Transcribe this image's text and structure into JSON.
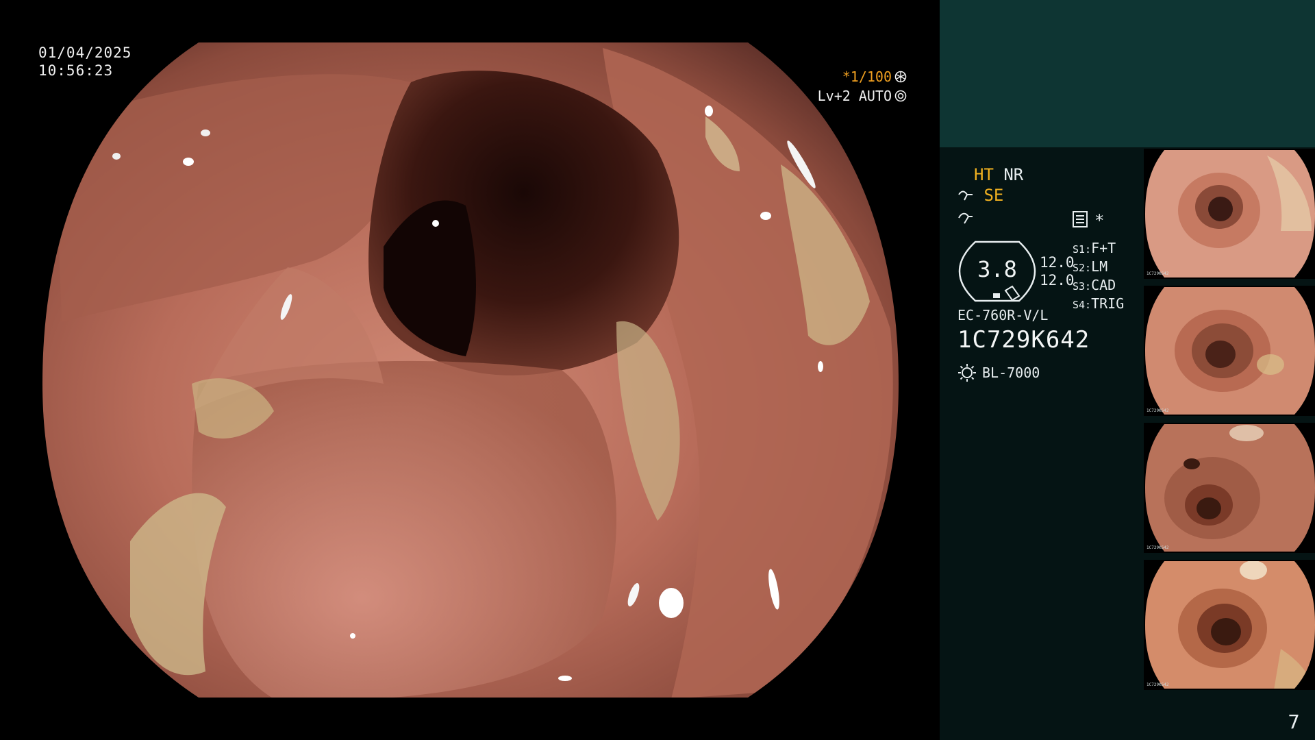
{
  "overlay": {
    "date": "01/04/2025",
    "time": "10:56:23",
    "shutter": "*1/100",
    "level": "Lv+2 AUTO"
  },
  "side_panel": {
    "enhance_ht": "HT",
    "enhance_nr": "NR",
    "enhance_se": "SE",
    "structure_value": "3.8",
    "sat_values": [
      "12.0",
      "12.0"
    ],
    "asterisk": "*",
    "modes": [
      {
        "key": "S1:",
        "value": "F+T"
      },
      {
        "key": "S2:",
        "value": "LM"
      },
      {
        "key": "S3:",
        "value": "CAD"
      },
      {
        "key": "S4:",
        "value": "TRIG"
      }
    ],
    "scope_model": "EC-760R-V/L",
    "serial": "1C729K642",
    "light_source": "BL-7000"
  },
  "thumbnails": [
    {
      "bl": "1C729K642"
    },
    {
      "bl": "1C729K642"
    },
    {
      "bl": "1C729K642"
    },
    {
      "bl": "1C729K642"
    }
  ],
  "page_number": "7",
  "colors": {
    "panel_bg": "#051414",
    "panel_top": "#0e3533",
    "accent_orange": "#f0a020",
    "tissue": "#b46a58"
  }
}
